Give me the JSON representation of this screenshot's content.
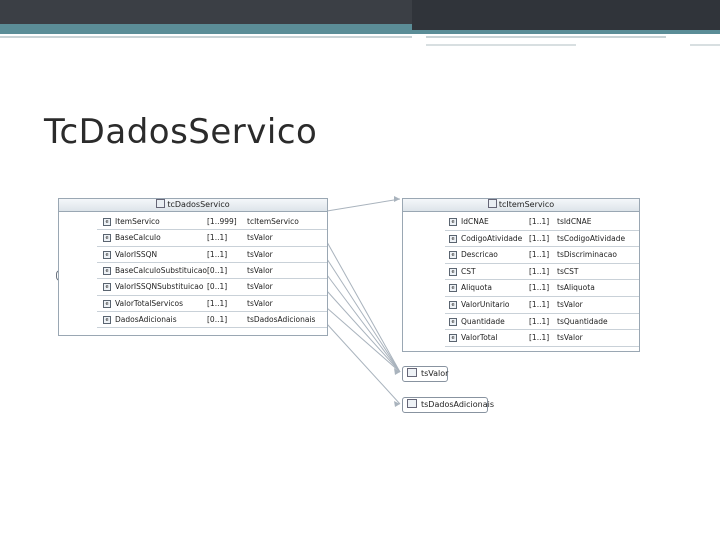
{
  "title": "Tc​Dados​Servico",
  "left_box": {
    "header": "tcDadosServico",
    "rows": [
      {
        "name": "ItemServico",
        "card": "[1..999]",
        "type": "tcItemServico"
      },
      {
        "name": "BaseCalculo",
        "card": "[1..1]",
        "type": "tsValor"
      },
      {
        "name": "ValorISSQN",
        "card": "[1..1]",
        "type": "tsValor"
      },
      {
        "name": "BaseCalculoSubstituicao",
        "card": "[0..1]",
        "type": "tsValor"
      },
      {
        "name": "ValorISSQNSubstituicao",
        "card": "[0..1]",
        "type": "tsValor"
      },
      {
        "name": "ValorTotalServicos",
        "card": "[1..1]",
        "type": "tsValor"
      },
      {
        "name": "DadosAdicionais",
        "card": "[0..1]",
        "type": "tsDadosAdicionais"
      }
    ]
  },
  "right_box": {
    "header": "tcItemServico",
    "rows": [
      {
        "name": "IdCNAE",
        "card": "[1..1]",
        "type": "tsIdCNAE"
      },
      {
        "name": "CodigoAtividade",
        "card": "[1..1]",
        "type": "tsCodigoAtividade"
      },
      {
        "name": "Descricao",
        "card": "[1..1]",
        "type": "tsDiscriminacao"
      },
      {
        "name": "CST",
        "card": "[1..1]",
        "type": "tsCST"
      },
      {
        "name": "Aliquota",
        "card": "[1..1]",
        "type": "tsAliquota"
      },
      {
        "name": "ValorUnitario",
        "card": "[1..1]",
        "type": "tsValor"
      },
      {
        "name": "Quantidade",
        "card": "[1..1]",
        "type": "tsQuantidade"
      },
      {
        "name": "ValorTotal",
        "card": "[1..1]",
        "type": "tsValor"
      }
    ]
  },
  "type_boxes": {
    "valor": "tsValor",
    "dados_adicionais": "tsDadosAdicionais"
  },
  "seq_glyph": "•••",
  "icon_glyph": "e",
  "colors": {
    "banner_dark": "#3b3f45",
    "banner_teal": "#5b8d97",
    "connector": "#a9b3bd"
  }
}
